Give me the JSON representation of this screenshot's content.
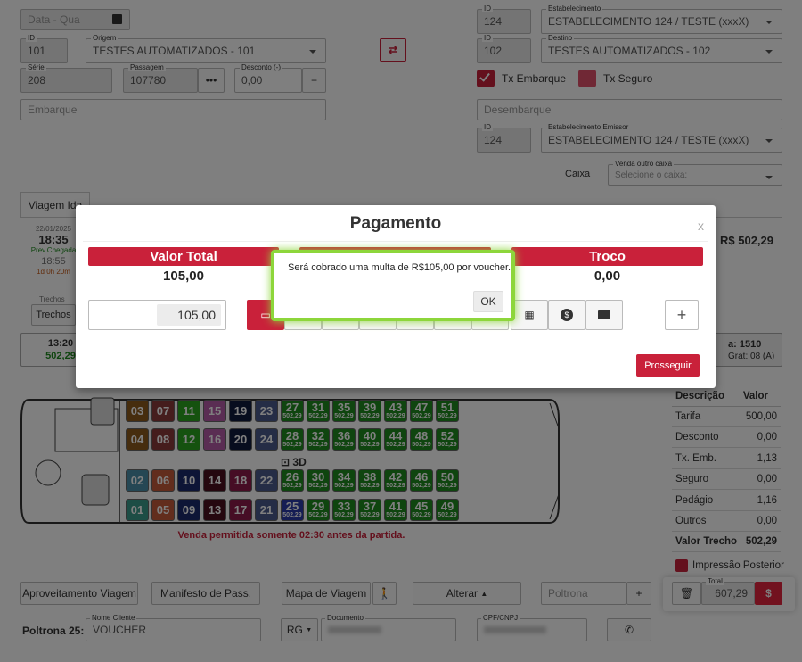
{
  "form": {
    "data_placeholder": "Data - Qua",
    "id_label": "ID",
    "origem_label": "Origem",
    "origem_id": "101",
    "origem_value": "TESTES AUTOMATIZADOS - 101",
    "estab_label": "Estabelecimento",
    "estab_id": "124",
    "estab_value": "ESTABELECIMENTO 124 / TESTE (xxxX)",
    "destino_label": "Destino",
    "destino_id": "102",
    "destino_value": "TESTES AUTOMATIZADOS - 102",
    "serie_label": "Série",
    "serie_value": "208",
    "passagem_label": "Passagem",
    "passagem_value": "107780",
    "passagem_btn": "•••",
    "desconto_label": "Desconto (-)",
    "desconto_value": "0,00",
    "desconto_btn": "−",
    "tx_embarque": "Tx Embarque",
    "tx_seguro": "Tx Seguro",
    "embarque_placeholder": "Embarque",
    "desembarque_placeholder": "Desembarque",
    "emissor_label": "Estabelecimento Emissor",
    "emissor_id": "124",
    "emissor_value": "ESTABELECIMENTO 124 / TESTE (xxxX)",
    "caixa_label": "Caixa",
    "venda_outro_caixa_label": "Venda outro caixa",
    "venda_outro_caixa_placeholder": "Selecione o caixa:"
  },
  "trip": {
    "tab": "Viagem Ida",
    "date": "22/01/2025",
    "time": "18:35",
    "prev_chegada": "Prev.Chegada",
    "arrival": "18:55",
    "duration": "1d 0h 20m",
    "trechos_label": "Trechos",
    "trechos_btn": "Trechos",
    "price": "R$ 502,29",
    "card_time": "13:20",
    "card_price": "502,29",
    "card_right_1": "a: 1510",
    "card_right_2": "Grat: 08 (A)"
  },
  "bus": {
    "deck_label": "3D",
    "warning": "Venda permitida somente 02:30 antes da partida."
  },
  "seats": [
    {
      "n": "03",
      "p": "",
      "c": "#8c5a1c"
    },
    {
      "n": "07",
      "p": "",
      "c": "#8b3a3a"
    },
    {
      "n": "11",
      "p": "",
      "c": "#2aa51e"
    },
    {
      "n": "15",
      "p": "",
      "c": "#b45aa7"
    },
    {
      "n": "19",
      "p": "",
      "c": "#0f1a3c"
    },
    {
      "n": "23",
      "p": "",
      "c": "#4a5a8c"
    },
    {
      "n": "27",
      "p": "502,29",
      "c": "#1f8a1f"
    },
    {
      "n": "31",
      "p": "502,29",
      "c": "#1f8a1f"
    },
    {
      "n": "35",
      "p": "502,29",
      "c": "#1f8a1f"
    },
    {
      "n": "39",
      "p": "502,29",
      "c": "#1f8a1f"
    },
    {
      "n": "43",
      "p": "502,29",
      "c": "#1f8a1f"
    },
    {
      "n": "47",
      "p": "502,29",
      "c": "#1f8a1f"
    },
    {
      "n": "51",
      "p": "502,29",
      "c": "#1f8a1f"
    },
    {
      "n": "04",
      "p": "",
      "c": "#8c5a1c"
    },
    {
      "n": "08",
      "p": "",
      "c": "#8b3a3a"
    },
    {
      "n": "12",
      "p": "",
      "c": "#2aa51e"
    },
    {
      "n": "16",
      "p": "",
      "c": "#b45aa7"
    },
    {
      "n": "20",
      "p": "",
      "c": "#0f1a3c"
    },
    {
      "n": "24",
      "p": "",
      "c": "#4a5a8c"
    },
    {
      "n": "28",
      "p": "502,29",
      "c": "#1f8a1f"
    },
    {
      "n": "32",
      "p": "502,29",
      "c": "#1f8a1f"
    },
    {
      "n": "36",
      "p": "502,29",
      "c": "#1f8a1f"
    },
    {
      "n": "40",
      "p": "502,29",
      "c": "#1f8a1f"
    },
    {
      "n": "44",
      "p": "502,29",
      "c": "#1f8a1f"
    },
    {
      "n": "48",
      "p": "502,29",
      "c": "#1f8a1f"
    },
    {
      "n": "52",
      "p": "502,29",
      "c": "#1f8a1f"
    },
    {
      "n": "02",
      "p": "",
      "c": "#4a8fa8"
    },
    {
      "n": "06",
      "p": "",
      "c": "#c45a3a"
    },
    {
      "n": "10",
      "p": "",
      "c": "#1a2a6c"
    },
    {
      "n": "14",
      "p": "",
      "c": "#4a0f1f"
    },
    {
      "n": "18",
      "p": "",
      "c": "#8c1a4a"
    },
    {
      "n": "22",
      "p": "",
      "c": "#4a5a8c"
    },
    {
      "n": "26",
      "p": "502,29",
      "c": "#1f8a1f"
    },
    {
      "n": "30",
      "p": "502,29",
      "c": "#1f8a1f"
    },
    {
      "n": "34",
      "p": "502,29",
      "c": "#1f8a1f"
    },
    {
      "n": "38",
      "p": "502,29",
      "c": "#1f8a1f"
    },
    {
      "n": "42",
      "p": "502,29",
      "c": "#1f8a1f"
    },
    {
      "n": "46",
      "p": "502,29",
      "c": "#1f8a1f"
    },
    {
      "n": "50",
      "p": "502,29",
      "c": "#1f8a1f"
    },
    {
      "n": "01",
      "p": "",
      "c": "#3a9a8a"
    },
    {
      "n": "05",
      "p": "",
      "c": "#c45a3a"
    },
    {
      "n": "09",
      "p": "",
      "c": "#1a2a6c"
    },
    {
      "n": "13",
      "p": "",
      "c": "#4a0f1f"
    },
    {
      "n": "17",
      "p": "",
      "c": "#8c1a4a"
    },
    {
      "n": "21",
      "p": "",
      "c": "#4a5a8c"
    },
    {
      "n": "25",
      "p": "502,29",
      "c": "#2a3aa8"
    },
    {
      "n": "29",
      "p": "502,29",
      "c": "#1f8a1f"
    },
    {
      "n": "33",
      "p": "502,29",
      "c": "#1f8a1f"
    },
    {
      "n": "37",
      "p": "502,29",
      "c": "#1f8a1f"
    },
    {
      "n": "41",
      "p": "502,29",
      "c": "#1f8a1f"
    },
    {
      "n": "45",
      "p": "502,29",
      "c": "#1f8a1f"
    },
    {
      "n": "49",
      "p": "502,29",
      "c": "#1f8a1f"
    }
  ],
  "summary": {
    "head_desc": "Descrição",
    "head_val": "Valor",
    "rows": [
      {
        "l": "Tarifa",
        "v": "500,00"
      },
      {
        "l": "Desconto",
        "v": "0,00"
      },
      {
        "l": "Tx. Emb.",
        "v": "1,13"
      },
      {
        "l": "Seguro",
        "v": "0,00"
      },
      {
        "l": "Pedágio",
        "v": "1,16"
      },
      {
        "l": "Outros",
        "v": "0,00"
      },
      {
        "l": "Valor Trecho",
        "v": "502,29"
      }
    ],
    "impressao": "Impressão Posterior",
    "total_label": "Total",
    "total_value": "607,29"
  },
  "bottom": {
    "aproveitamento": "Aproveitamento Viagem",
    "manifesto": "Manifesto de Pass.",
    "mapa": "Mapa de Viagem",
    "alterar": "Alterar",
    "poltrona_placeholder": "Poltrona",
    "add": "+",
    "poltrona_label": "Poltrona 25:",
    "nome_label": "Nome Cliente",
    "nome_value": "VOUCHER",
    "doc_type": "RG",
    "documento_label": "Documento",
    "cpf_label": "CPF/CNPJ"
  },
  "modal": {
    "title": "Pagamento",
    "close": "x",
    "valor_total_label": "Valor Total",
    "valor_total": "105,00",
    "troco_label": "Troco",
    "troco": "0,00",
    "amount_input": "105,00",
    "add": "+",
    "prosseguir": "Prosseguir"
  },
  "alert": {
    "message": "Será cobrado uma multa de R$105,00 por voucher.",
    "ok": "OK"
  },
  "colors": {
    "accent": "#c9213a",
    "green": "#1f8a1f",
    "alert_border": "#8dd63b"
  }
}
